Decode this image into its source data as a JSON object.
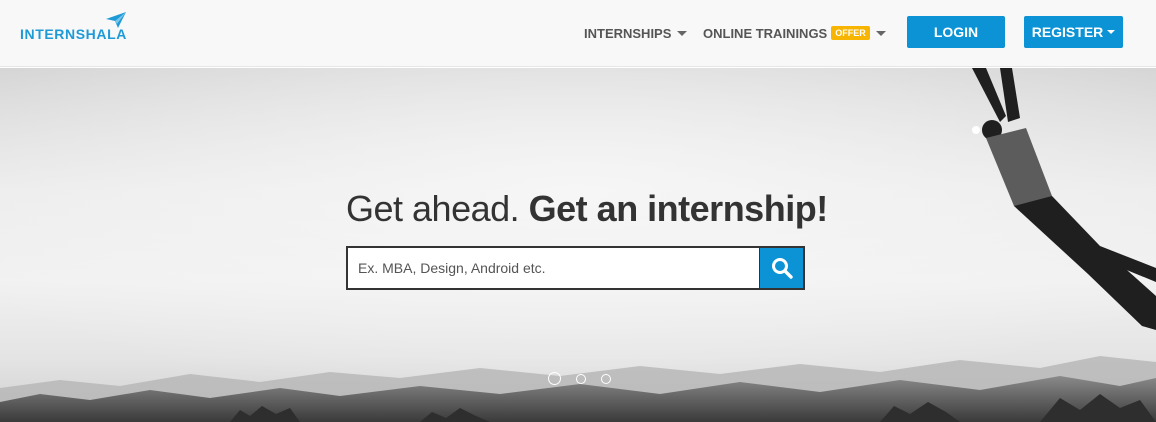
{
  "brand": {
    "name": "INTERNSHALA",
    "color": "#1e9ad6"
  },
  "nav": {
    "internships_label": "INTERNSHIPS",
    "trainings_label": "ONLINE TRAININGS",
    "offer_badge": "OFFER",
    "login_label": "LOGIN",
    "register_label": "REGISTER"
  },
  "hero": {
    "headline_light": "Get ahead.",
    "headline_bold": "Get an internship!",
    "search_placeholder": "Ex. MBA, Design, Android etc.",
    "search_value": "",
    "slides": {
      "count": 3,
      "active": 1
    }
  },
  "icons": {
    "logo": "paper-plane-icon",
    "search": "search-icon",
    "caret": "caret-down-icon"
  },
  "colors": {
    "primary": "#0b93d5",
    "offer": "#f7b500",
    "nav_text": "#555555",
    "headline": "#333333"
  }
}
